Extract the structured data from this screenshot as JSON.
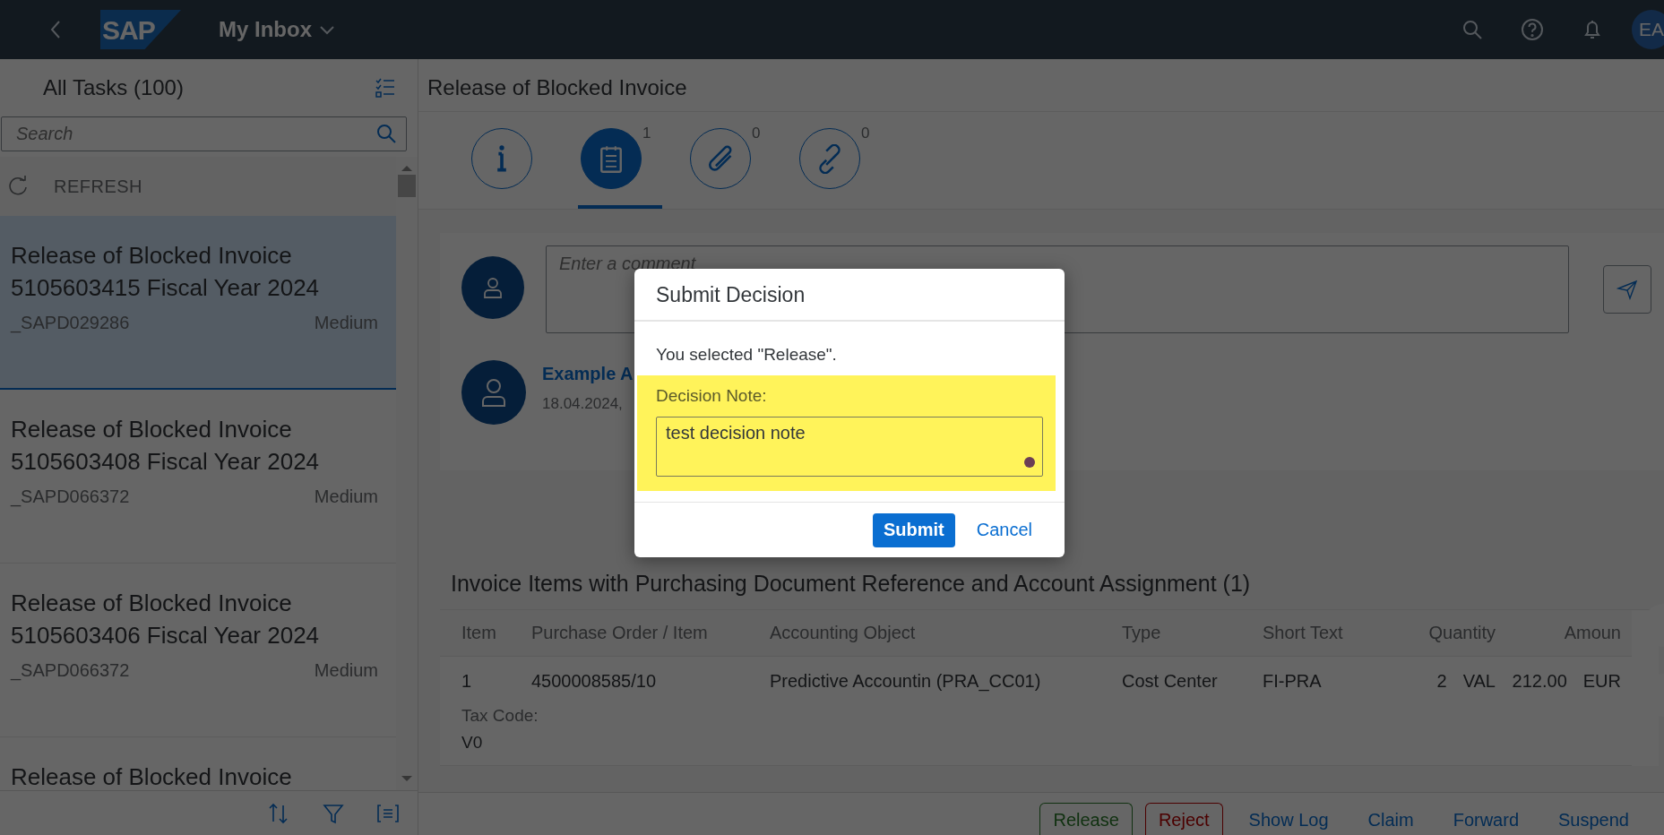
{
  "shell": {
    "logo": "SAP",
    "title": "My Inbox",
    "avatar": "EA"
  },
  "task_list": {
    "title": "All Tasks (100)",
    "search": {
      "placeholder": "Search"
    },
    "refresh": "REFRESH",
    "items": [
      {
        "title": "Release of Blocked Invoice 5105603415 Fiscal Year 2024",
        "creator": "_SAPD029286",
        "priority": "Medium",
        "selected": true
      },
      {
        "title": "Release of Blocked Invoice 5105603408 Fiscal Year 2024",
        "creator": "_SAPD066372",
        "priority": "Medium",
        "selected": false
      },
      {
        "title": "Release of Blocked Invoice 5105603406 Fiscal Year 2024",
        "creator": "_SAPD066372",
        "priority": "Medium",
        "selected": false
      },
      {
        "title": "Release of Blocked Invoice",
        "selected": false
      }
    ]
  },
  "detail": {
    "title": "Release of Blocked Invoice",
    "tabs": [
      {
        "kind": "info",
        "selected": false
      },
      {
        "kind": "notes",
        "count": "1",
        "selected": true
      },
      {
        "kind": "attachments",
        "count": "0",
        "selected": false
      },
      {
        "kind": "links",
        "count": "0",
        "selected": false
      }
    ],
    "comment": {
      "placeholder": "Enter a comment"
    },
    "note": {
      "author": "Example A",
      "date": "18.04.2024,"
    },
    "table": {
      "title": "Invoice Items with Purchasing Document Reference and Account Assignment (1)",
      "columns": [
        "Item",
        "Purchase Order / Item",
        "Accounting Object",
        "Type",
        "Short Text",
        "Quantity",
        "Amoun"
      ],
      "rows": [
        {
          "cells": [
            "1",
            "4500008585/10",
            "Predictive Accountin (PRA_CC01)",
            "Cost Center",
            "FI-PRA"
          ],
          "quantity": "2",
          "unit": "VAL",
          "amount": "212.00",
          "currency": "EUR",
          "tax_label": "Tax Code:",
          "tax_value": "V0"
        }
      ]
    },
    "actions": [
      {
        "label": "Release",
        "kind": "accept"
      },
      {
        "label": "Reject",
        "kind": "reject"
      },
      {
        "label": "Show Log",
        "kind": "plain"
      },
      {
        "label": "Claim",
        "kind": "plain"
      },
      {
        "label": "Forward",
        "kind": "plain"
      },
      {
        "label": "Suspend",
        "kind": "plain"
      }
    ]
  },
  "dialog": {
    "title": "Submit Decision",
    "message": "You selected \"Release\".",
    "field_label": "Decision Note:",
    "value": "test decision note",
    "buttons": [
      {
        "label": "Submit",
        "kind": "emphasized"
      },
      {
        "label": "Cancel",
        "kind": "transparent"
      }
    ]
  }
}
